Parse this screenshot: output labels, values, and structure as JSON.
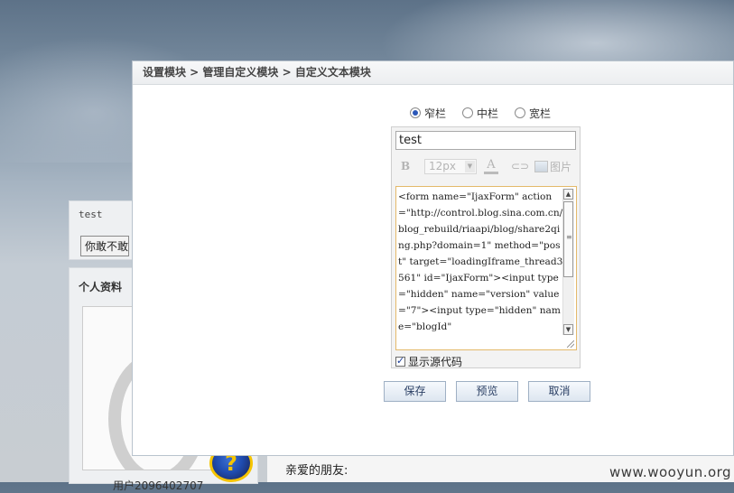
{
  "dialog": {
    "breadcrumb": "设置模块 > 管理自定义模块 > 自定义文本模块",
    "layout_options": [
      {
        "label": "窄栏",
        "selected": true
      },
      {
        "label": "中栏",
        "selected": false
      },
      {
        "label": "宽栏",
        "selected": false
      }
    ],
    "title_value": "test",
    "toolbar": {
      "bold_label": "B",
      "font_size": "12px",
      "font_color_label": "A",
      "link_icon": "⊂⊃",
      "image_label": "图片"
    },
    "code_value": "<form name=\"IjaxForm\" action=\"http://control.blog.sina.com.cn/blog_rebuild/riaapi/blog/share2qing.php?domain=1\" method=\"post\" target=\"loadingIframe_thread3561\" id=\"IjaxForm\"><input type=\"hidden\" name=\"version\" value=\"7\"><input type=\"hidden\" name=\"blogId\"",
    "show_source_label": "显示源代码",
    "show_source_checked": true,
    "buttons": {
      "save": "保存",
      "preview": "预览",
      "cancel": "取消"
    }
  },
  "background": {
    "module_title": "test",
    "module_button": "你敢不敢",
    "profile_title": "个人资料",
    "profile_name": "用户2096402707",
    "greeting": "亲爱的朋友:",
    "help_badge": "?",
    "watermark": "www.wooyun.org"
  }
}
